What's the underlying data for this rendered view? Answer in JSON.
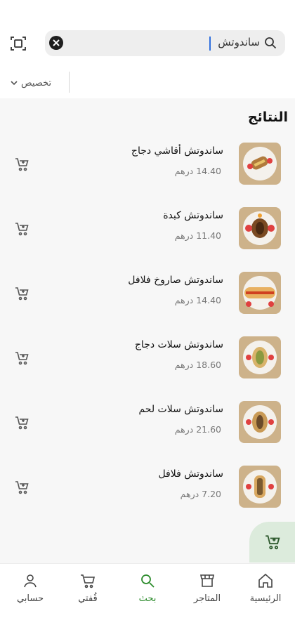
{
  "search": {
    "value": "ساندوتش"
  },
  "filter": {
    "label": "تخصيص"
  },
  "results": {
    "title": "النتائج",
    "items": [
      {
        "name": "ساندوتش أقاشي دجاج",
        "price": "14.40 درهم"
      },
      {
        "name": "ساندوتش كبدة",
        "price": "11.40 درهم"
      },
      {
        "name": "ساندوتش صاروخ فلافل",
        "price": "14.40 درهم"
      },
      {
        "name": "ساندوتش سلات دجاج",
        "price": "18.60 درهم"
      },
      {
        "name": "ساندوتش سلات لحم",
        "price": "21.60 درهم"
      },
      {
        "name": "ساندوتش فلافل",
        "price": "7.20 درهم"
      }
    ]
  },
  "bottom_nav": {
    "items": [
      {
        "label": "الرئيسية",
        "icon": "home-icon"
      },
      {
        "label": "المتاجر",
        "icon": "store-icon"
      },
      {
        "label": "بحث",
        "icon": "search-icon"
      },
      {
        "label": "قُفتي",
        "icon": "cart-icon"
      },
      {
        "label": "حسابي",
        "icon": "user-icon"
      }
    ],
    "active": "بحث"
  },
  "colors": {
    "accent": "#2a8a2a",
    "fab_bg": "#dcebdc",
    "search_bg": "#eeeeee"
  }
}
